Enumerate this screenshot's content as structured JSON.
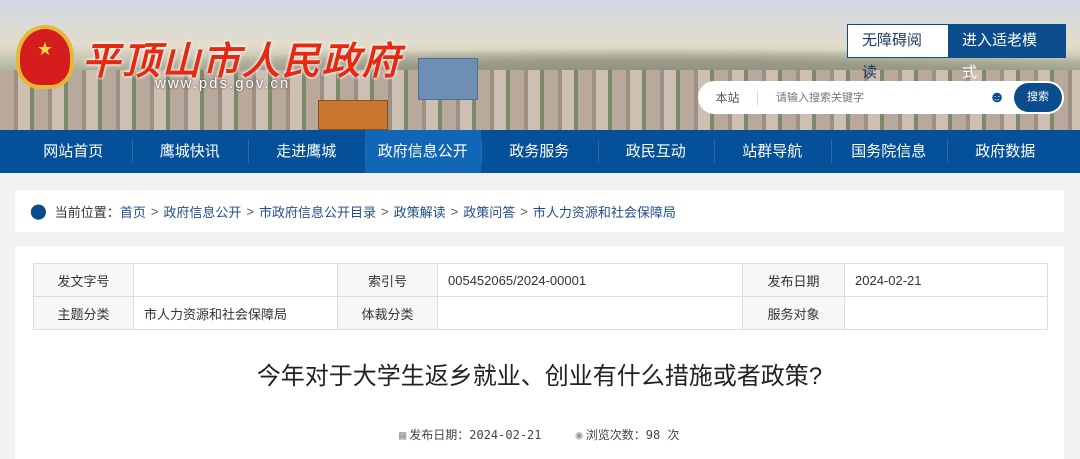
{
  "header": {
    "site_title": "平顶山市人民政府",
    "site_url": "www.pds.gov.cn",
    "accessible_read": "无障碍阅读",
    "elder_mode": "进入适老模式",
    "search_scope": "本站",
    "search_placeholder": "请输入搜索关键字",
    "search_button": "搜索"
  },
  "nav": {
    "items": [
      "网站首页",
      "鹰城快讯",
      "走进鹰城",
      "政府信息公开",
      "政务服务",
      "政民互动",
      "站群导航",
      "国务院信息",
      "政府数据"
    ],
    "active": "政府信息公开"
  },
  "breadcrumb": {
    "label": "当前位置：",
    "items": [
      "首页",
      "政府信息公开",
      "市政府信息公开目录",
      "政策解读",
      "政策问答",
      "市人力资源和社会保障局"
    ]
  },
  "info_table": {
    "rows": [
      [
        "发文字号",
        "",
        "索引号",
        "005452065/2024-00001",
        "发布日期",
        "2024-02-21"
      ],
      [
        "主题分类",
        "市人力资源和社会保障局",
        "体裁分类",
        "",
        "服务对象",
        ""
      ]
    ]
  },
  "article": {
    "title": "今年对于大学生返乡就业、创业有什么措施或者政策?",
    "publish_label": "发布日期：",
    "publish_date": "2024-02-21",
    "views_label": "浏览次数：",
    "views": "98",
    "views_unit": "次"
  },
  "colors": {
    "nav": "#04519a",
    "nav_active": "#1167b5",
    "title_red": "#e62a12"
  }
}
